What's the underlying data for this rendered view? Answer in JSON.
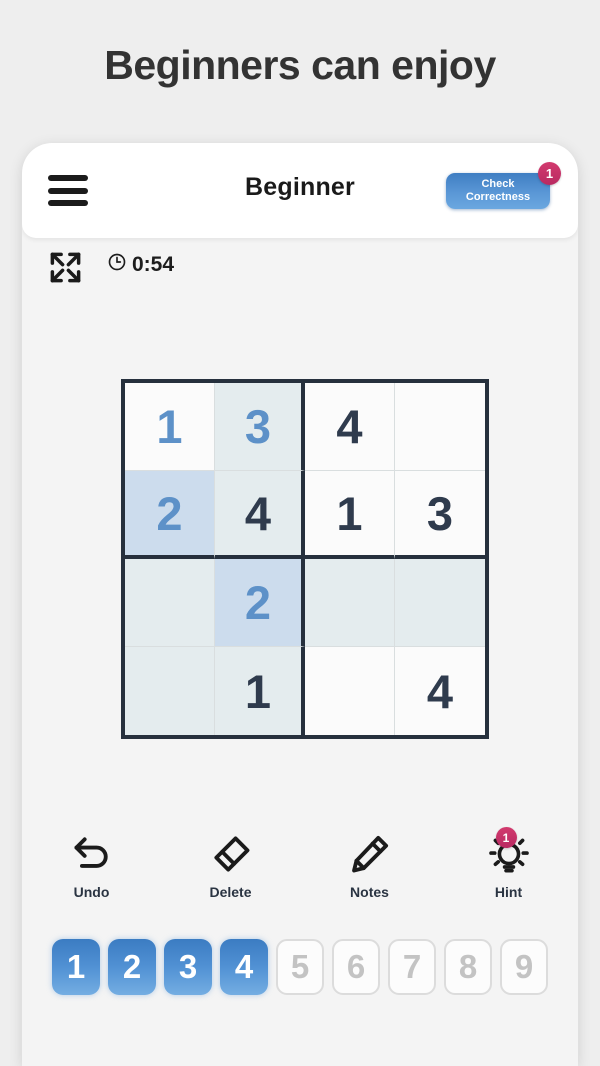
{
  "promo": {
    "headline": "Beginners can enjoy"
  },
  "appbar": {
    "menu_icon": "hamburger-icon",
    "title": "Beginner",
    "check_button": {
      "line1": "Check",
      "line2": "Correctness",
      "badge": "1"
    }
  },
  "status": {
    "fullscreen_icon": "fullscreen-expand-icon",
    "clock_icon": "clock-icon",
    "time": "0:54"
  },
  "board": {
    "rows": [
      [
        {
          "value": "1",
          "state": "user"
        },
        {
          "value": "3",
          "state": "user-tint"
        },
        {
          "value": "4",
          "state": "given"
        },
        {
          "value": "",
          "state": "empty"
        }
      ],
      [
        {
          "value": "2",
          "state": "selected"
        },
        {
          "value": "4",
          "state": "given-tint"
        },
        {
          "value": "1",
          "state": "given"
        },
        {
          "value": "3",
          "state": "given"
        }
      ],
      [
        {
          "value": "",
          "state": "empty-tint"
        },
        {
          "value": "2",
          "state": "selected"
        },
        {
          "value": "",
          "state": "empty-tint"
        },
        {
          "value": "",
          "state": "empty-tint"
        }
      ],
      [
        {
          "value": "",
          "state": "empty-tint"
        },
        {
          "value": "1",
          "state": "given-tint"
        },
        {
          "value": "",
          "state": "empty"
        },
        {
          "value": "4",
          "state": "given"
        }
      ]
    ]
  },
  "tools": [
    {
      "label": "Undo",
      "icon": "undo-arrow-icon",
      "badge": ""
    },
    {
      "label": "Delete",
      "icon": "eraser-icon",
      "badge": ""
    },
    {
      "label": "Notes",
      "icon": "pencil-icon",
      "badge": ""
    },
    {
      "label": "Hint",
      "icon": "lightbulb-icon",
      "badge": "1"
    }
  ],
  "numpad": [
    {
      "label": "1",
      "enabled": true
    },
    {
      "label": "2",
      "enabled": true
    },
    {
      "label": "3",
      "enabled": true
    },
    {
      "label": "4",
      "enabled": true
    },
    {
      "label": "5",
      "enabled": false
    },
    {
      "label": "6",
      "enabled": false
    },
    {
      "label": "7",
      "enabled": false
    },
    {
      "label": "8",
      "enabled": false
    },
    {
      "label": "9",
      "enabled": false
    }
  ],
  "colors": {
    "accent_blue": "#5191d4",
    "badge_pink": "#c72f66",
    "grid_border": "#26303d",
    "cell_tint": "#e4ecee",
    "cell_selected": "#ccdced",
    "user_digit": "#5d91c8",
    "given_digit": "#2f3b4d",
    "page_bg": "#eeeeee"
  }
}
